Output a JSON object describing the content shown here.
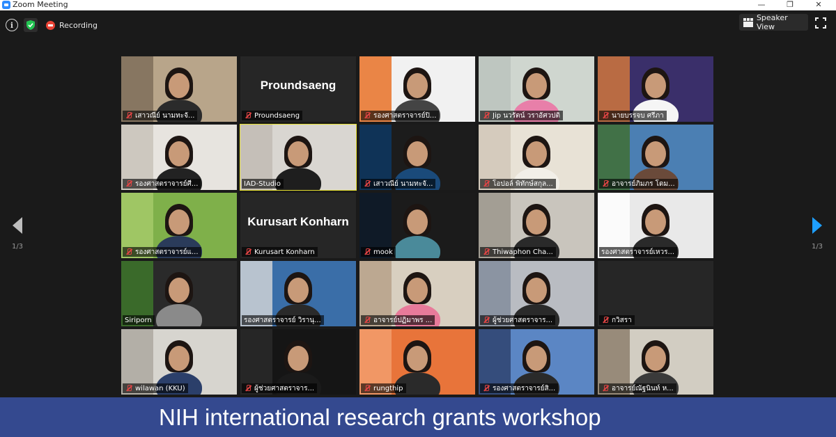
{
  "window": {
    "title": "Zoom Meeting",
    "minimize": "—",
    "restore": "❐",
    "close": "✕"
  },
  "toolbar": {
    "recording_label": "Recording",
    "view_button_label": "Speaker View"
  },
  "pagination": {
    "left_page": "1/3",
    "right_page": "1/3"
  },
  "participants": [
    {
      "name": "เสาวณีย์ นามทะจั...",
      "muted": true,
      "video": true,
      "bg": "#b8a58a",
      "shirt": "#2b2b2b",
      "side": "#7a6a56"
    },
    {
      "name": "Proundsaeng",
      "muted": true,
      "video": false
    },
    {
      "name": "รองศาสตราจารย์ปิ...",
      "muted": true,
      "video": true,
      "bg": "#f1f1f1",
      "shirt": "#444444",
      "side": "#e86a1c"
    },
    {
      "name": "Jip นวรัตน์ วราอัศวปติ",
      "muted": true,
      "video": true,
      "bg": "#cfd6cf",
      "shirt": "#e87fa9",
      "side": "#b9c2bc"
    },
    {
      "name": "นายบรรจบ ศรีภา",
      "muted": true,
      "video": true,
      "bg": "#3a2f6a",
      "shirt": "#f5f5f5",
      "side": "#d97a3a"
    },
    {
      "name": "รองศาสตราจารย์ศี...",
      "muted": true,
      "video": true,
      "bg": "#e7e4df",
      "shirt": "#222222",
      "side": "#c7c1b6"
    },
    {
      "name": "IAD-Studio",
      "muted": false,
      "video": true,
      "active": true,
      "bg": "#d9d6d1",
      "shirt": "#1e1e1e",
      "side": "#bfb9b1"
    },
    {
      "name": "เสาวณีย์ นามทะจั...",
      "muted": true,
      "video": true,
      "bg": "#1c1c1c",
      "shirt": "#1a4a7a",
      "side": "#0d3a66"
    },
    {
      "name": "โอปอล์ พิทักษ์สกุล...",
      "muted": true,
      "video": true,
      "bg": "#e8e2d6",
      "shirt": "#f2efe8",
      "side": "#cfc6b6"
    },
    {
      "name": "อาจารย์ภิมภร โดม...",
      "muted": true,
      "video": true,
      "bg": "#4b7fb3",
      "shirt": "#6a4a3a",
      "side": "#3f6e2c"
    },
    {
      "name": "รองศาสตราจารย์แ...",
      "muted": true,
      "video": true,
      "bg": "#7fb04a",
      "shirt": "#2a3b5a",
      "side": "#a7cc6a"
    },
    {
      "name": "Kurusart Konharn",
      "muted": true,
      "video": false
    },
    {
      "name": "mook",
      "muted": true,
      "video": true,
      "bg": "#1b1b1b",
      "shirt": "#4a8a9a",
      "side": "#0c1a2a"
    },
    {
      "name": "Thiwaphon Cha...",
      "muted": true,
      "video": true,
      "bg": "#c9c5bd",
      "shirt": "#2a2a2a",
      "side": "#9a948a"
    },
    {
      "name": "รองศาสตราจารย์เหวร...",
      "muted": false,
      "video": true,
      "bg": "#e9e9e9",
      "shirt": "#2a2a2a",
      "side": "#ffffff"
    },
    {
      "name": "Siriporn",
      "muted": false,
      "video": true,
      "bg": "#2a2a2a",
      "shirt": "#8a8a8a",
      "side": "#3f7a2a"
    },
    {
      "name": "รองศาสตราจารย์ วิรานุ...",
      "muted": false,
      "video": true,
      "bg": "#3a6ea8",
      "shirt": "#2a2a2a",
      "side": "#d8d8d8"
    },
    {
      "name": "อาจารย์ปฏิมาพร ...",
      "muted": true,
      "video": true,
      "bg": "#d8cfc0",
      "shirt": "#e87a9a",
      "side": "#b59d84"
    },
    {
      "name": "ผู้ช่วยศาสตราจาร...",
      "muted": true,
      "video": true,
      "bg": "#b9bcc2",
      "shirt": "#2a2a2a",
      "side": "#7f8a9a"
    },
    {
      "name": "กวิสรา",
      "muted": true,
      "video": false
    },
    {
      "name": "wilawan (KKU)",
      "muted": true,
      "video": true,
      "bg": "#d7d5cf",
      "shirt": "#2b3f6a",
      "side": "#aaa59c"
    },
    {
      "name": "ผู้ช่วยศาสตราจาร...",
      "muted": true,
      "video": true,
      "bg": "#151515",
      "shirt": "#1a1a1a",
      "side": "#2a2a2a"
    },
    {
      "name": "rungthip",
      "muted": true,
      "video": true,
      "bg": "#e8743a",
      "shirt": "#2a2a2a",
      "side": "#f3a070"
    },
    {
      "name": "รองศาสตราจารย์สิ...",
      "muted": true,
      "video": true,
      "bg": "#5b86c4",
      "shirt": "#2a2a2a",
      "side": "#2c3e6a"
    },
    {
      "name": "อาจารย์ณัฐนินท์ ห...",
      "muted": true,
      "video": true,
      "bg": "#d2cdc2",
      "shirt": "#3a3a3a",
      "side": "#8a7a68"
    }
  ],
  "banner": {
    "text": "NIH international research grants workshop"
  }
}
